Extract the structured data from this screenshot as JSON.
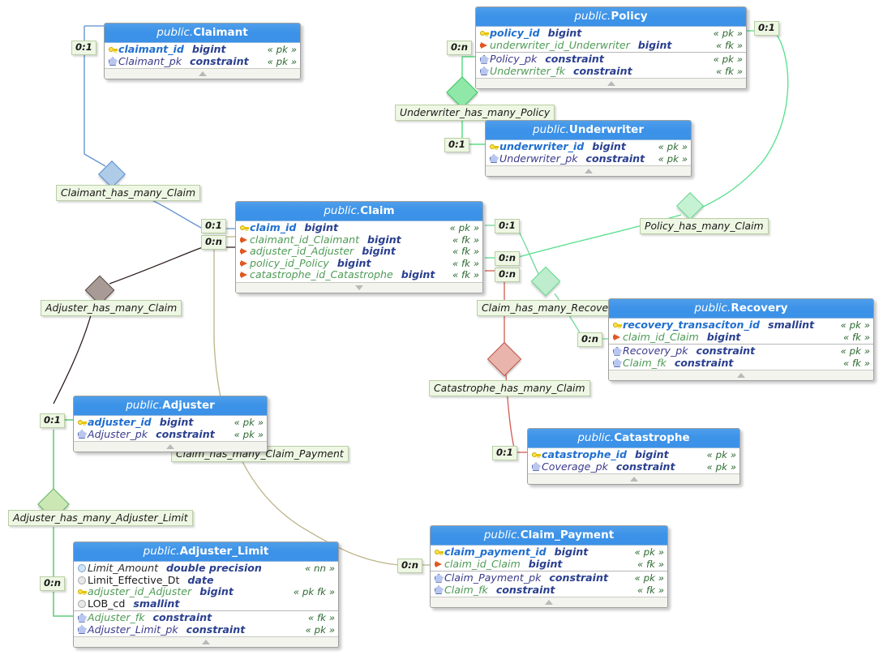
{
  "diagram": {
    "type": "entity-relationship-diagram",
    "schema": "public",
    "colors": {
      "header": "#3d93e8",
      "label_bg": "#eef7e3",
      "green_link": "#52e08a",
      "blue_link": "#5b8fd0",
      "dark_link": "#2b1a1a",
      "khaki_link": "#bdb48a",
      "red_link": "#d05c52",
      "light_green_link": "#6fd79a"
    }
  },
  "tables": [
    {
      "id": "claimant",
      "schema": "public.",
      "name": "Claimant",
      "columns": [
        {
          "icon": "key-icon",
          "name": "claimant_id",
          "style": "pk",
          "type": "bigint",
          "stereo": "« pk »"
        },
        {
          "icon": "pentagon-icon",
          "name": "Claimant_pk",
          "style": "cons",
          "type": "constraint",
          "stereo": "« pk »"
        }
      ],
      "footer_icon": "triangle-up-icon"
    },
    {
      "id": "policy",
      "schema": "public.",
      "name": "Policy",
      "columns": [
        {
          "icon": "key-icon",
          "name": "policy_id",
          "style": "pk",
          "type": "bigint",
          "stereo": "« pk »"
        },
        {
          "icon": "arrow-icon",
          "name": "underwriter_id_Underwriter",
          "style": "fk",
          "type": "bigint",
          "stereo": "« fk »"
        }
      ],
      "constraints": [
        {
          "icon": "pentagon-icon",
          "name": "Policy_pk",
          "style": "cons",
          "type": "constraint",
          "stereo": "« pk »"
        },
        {
          "icon": "pentagon-icon",
          "name": "Underwriter_fk",
          "style": "consf",
          "type": "constraint",
          "stereo": "« fk »"
        }
      ],
      "footer_icon": "triangle-up-icon"
    },
    {
      "id": "underwriter",
      "schema": "public.",
      "name": "Underwriter",
      "columns": [
        {
          "icon": "key-icon",
          "name": "underwriter_id",
          "style": "pk",
          "type": "bigint",
          "stereo": "« pk »"
        },
        {
          "icon": "pentagon-icon",
          "name": "Underwriter_pk",
          "style": "cons",
          "type": "constraint",
          "stereo": "« pk »"
        }
      ],
      "footer_icon": "triangle-up-icon"
    },
    {
      "id": "claim",
      "schema": "public.",
      "name": "Claim",
      "columns": [
        {
          "icon": "key-icon",
          "name": "claim_id",
          "style": "pk",
          "type": "bigint",
          "stereo": "« pk »"
        },
        {
          "icon": "arrow-icon",
          "name": "claimant_id_Claimant",
          "style": "fk",
          "type": "bigint",
          "stereo": "« fk »"
        },
        {
          "icon": "arrow-icon",
          "name": "adjuster_id_Adjuster",
          "style": "fk",
          "type": "bigint",
          "stereo": "« fk »"
        },
        {
          "icon": "arrow-icon",
          "name": "policy_id_Policy",
          "style": "fk",
          "type": "bigint",
          "stereo": "« fk »"
        },
        {
          "icon": "arrow-icon",
          "name": "catastrophe_id_Catastrophe",
          "style": "fk",
          "type": "bigint",
          "stereo": "« fk »"
        }
      ],
      "footer_icon": "triangle-down-icon"
    },
    {
      "id": "recovery",
      "schema": "public.",
      "name": "Recovery",
      "columns": [
        {
          "icon": "key-icon",
          "name": "recovery_transaciton_id",
          "style": "pk",
          "type": "smallint",
          "stereo": "« pk »"
        },
        {
          "icon": "arrow-icon",
          "name": "claim_id_Claim",
          "style": "fk",
          "type": "bigint",
          "stereo": "« fk »"
        }
      ],
      "constraints": [
        {
          "icon": "pentagon-icon",
          "name": "Recovery_pk",
          "style": "cons",
          "type": "constraint",
          "stereo": "« pk »"
        },
        {
          "icon": "pentagon-icon",
          "name": "Claim_fk",
          "style": "consf",
          "type": "constraint",
          "stereo": "« fk »"
        }
      ],
      "footer_icon": "triangle-up-icon"
    },
    {
      "id": "adjuster",
      "schema": "public.",
      "name": "Adjuster",
      "columns": [
        {
          "icon": "key-icon",
          "name": "adjuster_id",
          "style": "pk",
          "type": "bigint",
          "stereo": "« pk »"
        },
        {
          "icon": "pentagon-icon",
          "name": "Adjuster_pk",
          "style": "cons",
          "type": "constraint",
          "stereo": "« pk »"
        }
      ],
      "footer_icon": "triangle-up-icon"
    },
    {
      "id": "catastrophe",
      "schema": "public.",
      "name": "Catastrophe",
      "columns": [
        {
          "icon": "key-icon",
          "name": "catastrophe_id",
          "style": "pk",
          "type": "bigint",
          "stereo": "« pk »"
        },
        {
          "icon": "pentagon-icon",
          "name": "Coverage_pk",
          "style": "cons",
          "type": "constraint",
          "stereo": "« pk »"
        }
      ],
      "footer_icon": "triangle-up-icon"
    },
    {
      "id": "claim_payment",
      "schema": "public.",
      "name": "Claim_Payment",
      "columns": [
        {
          "icon": "key-icon",
          "name": "claim_payment_id",
          "style": "pk",
          "type": "bigint",
          "stereo": "« pk »"
        },
        {
          "icon": "arrow-icon",
          "name": "claim_id_Claim",
          "style": "fk",
          "type": "bigint",
          "stereo": "« fk »"
        }
      ],
      "constraints": [
        {
          "icon": "pentagon-icon",
          "name": "Claim_Payment_pk",
          "style": "cons",
          "type": "constraint",
          "stereo": "« pk »"
        },
        {
          "icon": "pentagon-icon",
          "name": "Claim_fk",
          "style": "consf",
          "type": "constraint",
          "stereo": "« fk »"
        }
      ],
      "footer_icon": "triangle-up-icon"
    },
    {
      "id": "adjuster_limit",
      "schema": "public.",
      "name": "Adjuster_Limit",
      "columns": [
        {
          "icon": "circle-blue-icon",
          "name": "Limit_Amount",
          "style": "col",
          "type": "double precision",
          "stereo": "« nn »"
        },
        {
          "icon": "circle-grey-icon",
          "name": "Limit_Effective_Dt",
          "style": "colp",
          "type": "date",
          "stereo": ""
        },
        {
          "icon": "key-icon",
          "name": "adjuster_id_Adjuster",
          "style": "fk",
          "type": "bigint",
          "stereo": "« pk fk »"
        },
        {
          "icon": "circle-grey-icon",
          "name": "LOB_cd",
          "style": "colp",
          "type": "smallint",
          "stereo": ""
        }
      ],
      "constraints": [
        {
          "icon": "pentagon-icon",
          "name": "Adjuster_fk",
          "style": "consf",
          "type": "constraint",
          "stereo": "« fk »"
        },
        {
          "icon": "pentagon-icon",
          "name": "Adjuster_Limit_pk",
          "style": "cons",
          "type": "constraint",
          "stereo": "« pk »"
        }
      ],
      "footer_icon": "triangle-up-icon"
    }
  ],
  "relationships": [
    {
      "id": "claimant_claim",
      "label": "Claimant_has_many_Claim",
      "diamond_color": "#aecbe8",
      "line_color": "#5b8fd0"
    },
    {
      "id": "adjuster_claim",
      "label": "Adjuster_has_many_Claim",
      "diamond_color": "#a89a95",
      "line_color": "#2b1a1a"
    },
    {
      "id": "underwriter_policy",
      "label": "Underwriter_has_many_Policy",
      "diamond_color": "#8fe8a8",
      "line_color": "#3fd870"
    },
    {
      "id": "policy_claim",
      "label": "Policy_has_many_Claim",
      "diamond_color": "#c6f2d4",
      "line_color": "#52e08a"
    },
    {
      "id": "claim_recovery",
      "label": "Claim_has_many_Recovery",
      "diamond_color": "#c6f2d4",
      "line_color": "#6fd79a"
    },
    {
      "id": "catastrophe_claim",
      "label": "Catastrophe_has_many_Claim",
      "diamond_color": "#e8b4ac",
      "line_color": "#d05c52"
    },
    {
      "id": "claim_claim_payment",
      "label": "Claim_has_many_Claim_Payment",
      "diamond_color": "#bdb48a",
      "line_color": "#bdb48a"
    },
    {
      "id": "adjuster_adjuster_limit",
      "label": "Adjuster_has_many_Adjuster_Limit",
      "diamond_color": "#cbe8b4",
      "line_color": "#3fc060"
    }
  ],
  "cardinalities": [
    {
      "id": "c-claimant-left",
      "text": "0:1"
    },
    {
      "id": "c-policy-left",
      "text": "0:n"
    },
    {
      "id": "c-policy-right",
      "text": "0:1"
    },
    {
      "id": "c-underwriter-left",
      "text": "0:1"
    },
    {
      "id": "c-claim-left-1",
      "text": "0:1"
    },
    {
      "id": "c-claim-left-2",
      "text": "0:n"
    },
    {
      "id": "c-claim-right-1",
      "text": "0:1"
    },
    {
      "id": "c-claim-right-2",
      "text": "0:n"
    },
    {
      "id": "c-claim-right-3",
      "text": "0:n"
    },
    {
      "id": "c-recovery-left",
      "text": "0:n"
    },
    {
      "id": "c-adjuster-left",
      "text": "0:1"
    },
    {
      "id": "c-adjuster-limit-left",
      "text": "0:n"
    },
    {
      "id": "c-catastrophe-left",
      "text": "0:1"
    },
    {
      "id": "c-claim-payment-left",
      "text": "0:n"
    }
  ]
}
